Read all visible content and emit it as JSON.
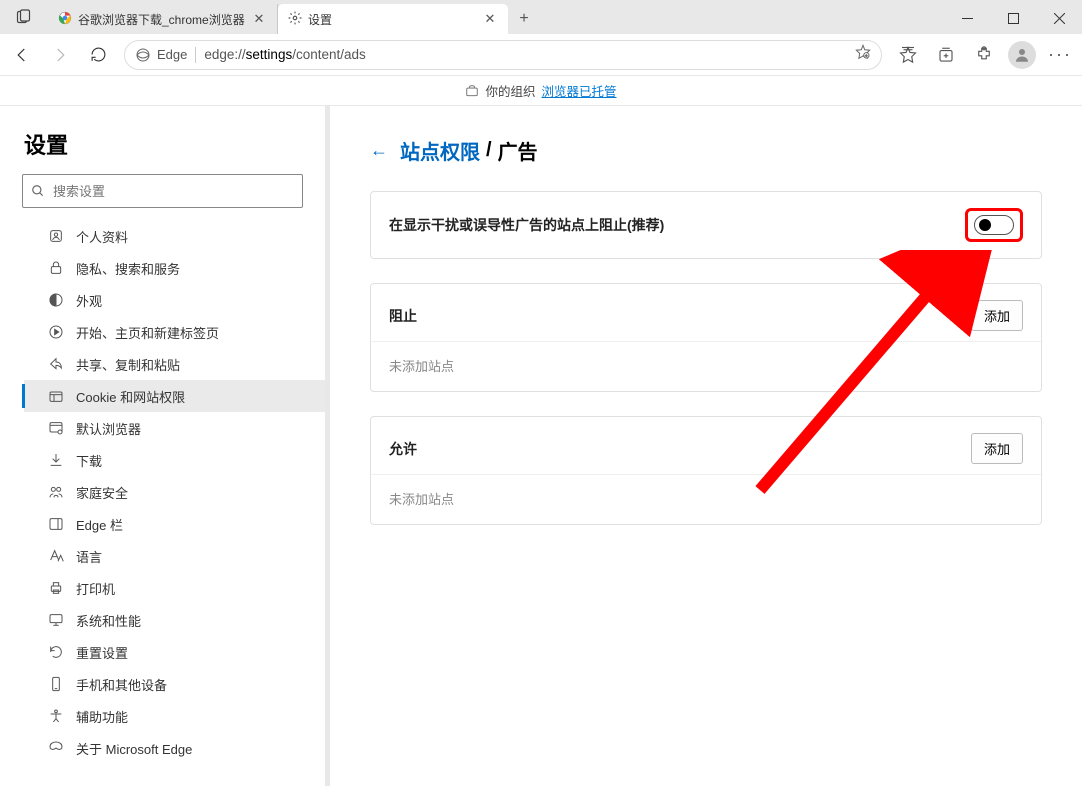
{
  "titlebar": {
    "tabs": [
      {
        "title": "谷歌浏览器下载_chrome浏览器",
        "icon": "chrome"
      },
      {
        "title": "设置",
        "icon": "gear"
      }
    ]
  },
  "toolbar": {
    "edge_label": "Edge",
    "url_prefix": "edge://",
    "url_bold": "settings",
    "url_rest": "/content/ads"
  },
  "org_banner": {
    "prefix": "你的组织",
    "link": "浏览器已托管"
  },
  "sidebar": {
    "title": "设置",
    "search_placeholder": "搜索设置",
    "items": [
      {
        "label": "个人资料",
        "icon": "person"
      },
      {
        "label": "隐私、搜索和服务",
        "icon": "lock"
      },
      {
        "label": "外观",
        "icon": "appearance"
      },
      {
        "label": "开始、主页和新建标签页",
        "icon": "start"
      },
      {
        "label": "共享、复制和粘贴",
        "icon": "share"
      },
      {
        "label": "Cookie 和网站权限",
        "icon": "cookie",
        "active": true
      },
      {
        "label": "默认浏览器",
        "icon": "browser"
      },
      {
        "label": "下载",
        "icon": "download"
      },
      {
        "label": "家庭安全",
        "icon": "family"
      },
      {
        "label": "Edge 栏",
        "icon": "edgebar"
      },
      {
        "label": "语言",
        "icon": "language"
      },
      {
        "label": "打印机",
        "icon": "printer"
      },
      {
        "label": "系统和性能",
        "icon": "system"
      },
      {
        "label": "重置设置",
        "icon": "reset"
      },
      {
        "label": "手机和其他设备",
        "icon": "phone"
      },
      {
        "label": "辅助功能",
        "icon": "accessibility"
      },
      {
        "label": "关于 Microsoft Edge",
        "icon": "about"
      }
    ]
  },
  "content": {
    "breadcrumb": {
      "link": "站点权限",
      "sep": "/",
      "current": "广告"
    },
    "toggle_label": "在显示干扰或误导性广告的站点上阻止(推荐)",
    "block": {
      "title": "阻止",
      "add": "添加",
      "empty": "未添加站点"
    },
    "allow": {
      "title": "允许",
      "add": "添加",
      "empty": "未添加站点"
    }
  },
  "annotation": {
    "highlight_color": "#ff0000"
  }
}
